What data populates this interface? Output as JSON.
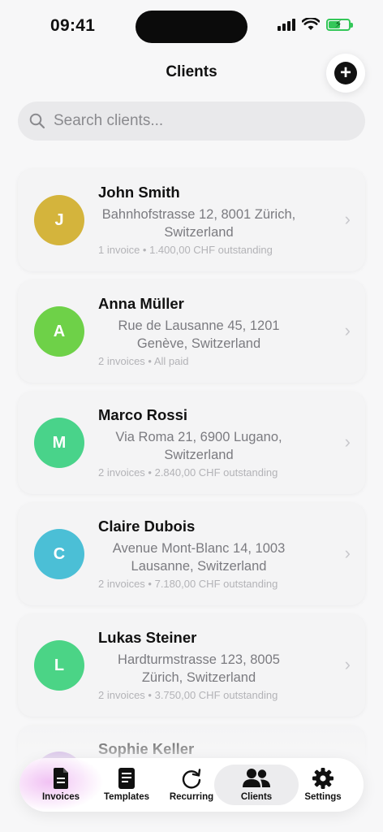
{
  "status_bar": {
    "time": "09:41"
  },
  "header": {
    "title": "Clients"
  },
  "search": {
    "placeholder": "Search clients..."
  },
  "clients": [
    {
      "initial": "J",
      "name": "John Smith",
      "address": "Bahnhofstrasse 12, 8001 Zürich, Switzerland",
      "meta": "1 invoice • 1.400,00 CHF outstanding",
      "color": "#d4b43c"
    },
    {
      "initial": "A",
      "name": "Anna Müller",
      "address": "Rue de Lausanne 45, 1201 Genève, Switzerland",
      "meta": "2 invoices • All paid",
      "color": "#6ed148"
    },
    {
      "initial": "M",
      "name": "Marco Rossi",
      "address": "Via Roma 21, 6900 Lugano, Switzerland",
      "meta": "2 invoices • 2.840,00 CHF outstanding",
      "color": "#49d38a"
    },
    {
      "initial": "C",
      "name": "Claire Dubois",
      "address": "Avenue Mont-Blanc 14, 1003 Lausanne, Switzerland",
      "meta": "2 invoices • 7.180,00 CHF outstanding",
      "color": "#4bbfd6"
    },
    {
      "initial": "L",
      "name": "Lukas Steiner",
      "address": "Hardturmstrasse 123, 8005 Zürich, Switzerland",
      "meta": "2 invoices • 3.750,00 CHF outstanding",
      "color": "#4bd486"
    },
    {
      "initial": "S",
      "name": "Sophie Keller",
      "address": "",
      "meta": "",
      "color": "#b07bd6"
    }
  ],
  "tabs": [
    {
      "label": "Invoices",
      "icon": "invoice-icon"
    },
    {
      "label": "Templates",
      "icon": "template-icon"
    },
    {
      "label": "Recurring",
      "icon": "recurring-icon"
    },
    {
      "label": "Clients",
      "icon": "clients-icon",
      "active": true
    },
    {
      "label": "Settings",
      "icon": "gear-icon"
    }
  ]
}
